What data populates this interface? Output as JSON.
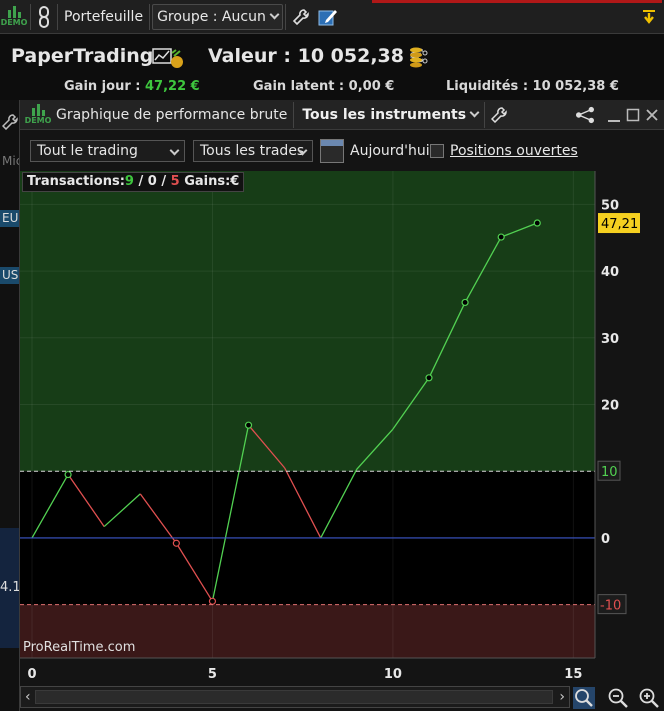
{
  "toolbar": {
    "demo_label": "DEMO",
    "portfolio_label": "Portefeuille",
    "group_label": "Groupe : Aucun"
  },
  "header": {
    "title": "PaperTrading",
    "value_text": "Valeur : 10 052,38 €",
    "gain_jour_label": "Gain jour :",
    "gain_jour_value": "47,22 €",
    "gain_latent_label": "Gain latent :",
    "gain_latent_value": "0,00 €",
    "liquidites_label": "Liquidités :",
    "liquidites_value": "10 052,38 €"
  },
  "background": {
    "tag_eu": "EU",
    "tag_us": "US",
    "partial_text": "Mic",
    "partial_number": "4.1"
  },
  "chart_window": {
    "demo_label": "DEMO",
    "title": "Graphique de performance brute",
    "instrument_filter": "Tous les instruments"
  },
  "filters": {
    "trading_select": "Tout le trading",
    "trades_select": "Tous les trades",
    "today_label": "Aujourd'hui",
    "open_positions_label": "Positions ouvertes"
  },
  "chart_data": {
    "type": "line",
    "transactions_label": "Transactions:",
    "tx_total": "9",
    "tx_mid": "0",
    "tx_losses": "5",
    "gains_label": "Gains:",
    "gains_unit": "€",
    "current_value_label": "47,21",
    "watermark": "ProRealTime.com",
    "xlim": [
      0,
      15.6
    ],
    "ylim": [
      -18,
      55
    ],
    "x_ticks": [
      0,
      5,
      10,
      15
    ],
    "y_ticks": [
      0,
      10,
      20,
      30,
      40,
      50
    ],
    "y_tick_labels": [
      "0",
      "10",
      "20",
      "30",
      "40",
      "50"
    ],
    "upper_threshold": 10,
    "upper_threshold_label": "10",
    "lower_threshold": -10,
    "lower_threshold_label": "-10",
    "points": [
      {
        "x": 0,
        "y": 0,
        "dir": "up",
        "marker": false
      },
      {
        "x": 1,
        "y": 9.5,
        "dir": "up",
        "marker": true
      },
      {
        "x": 2,
        "y": 1.7,
        "dir": "down",
        "marker": false
      },
      {
        "x": 3,
        "y": 6.6,
        "dir": "up",
        "marker": false
      },
      {
        "x": 4,
        "y": -0.8,
        "dir": "down",
        "marker": true
      },
      {
        "x": 5,
        "y": -9.5,
        "dir": "down",
        "marker": true
      },
      {
        "x": 6,
        "y": 16.9,
        "dir": "up",
        "marker": true
      },
      {
        "x": 7,
        "y": 10.5,
        "dir": "down",
        "marker": false
      },
      {
        "x": 8,
        "y": 0,
        "dir": "down",
        "marker": false
      },
      {
        "x": 9,
        "y": 10.3,
        "dir": "up",
        "marker": false
      },
      {
        "x": 10,
        "y": 16.3,
        "dir": "up",
        "marker": false
      },
      {
        "x": 11,
        "y": 24,
        "dir": "up",
        "marker": true
      },
      {
        "x": 12,
        "y": 35.3,
        "dir": "up",
        "marker": true
      },
      {
        "x": 13,
        "y": 45.1,
        "dir": "up",
        "marker": true
      },
      {
        "x": 14,
        "y": 47.2,
        "dir": "up",
        "marker": true
      }
    ]
  },
  "colors": {
    "up": "#52d152",
    "down": "#e05050",
    "green_zone": "#173d17",
    "red_zone": "#3a1818",
    "zero_line": "#3b56c9",
    "badge": "#f5d020"
  }
}
